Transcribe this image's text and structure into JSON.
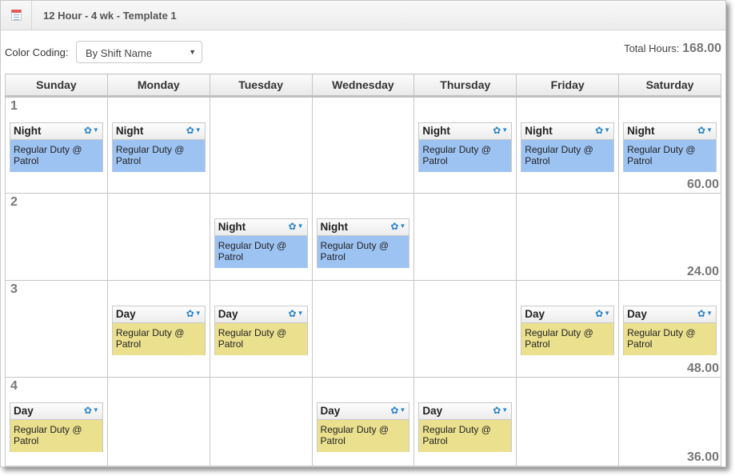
{
  "header": {
    "title": "12 Hour - 4 wk - Template 1",
    "icon": "calendar-icon"
  },
  "toolbar": {
    "color_coding_label": "Color Coding:",
    "color_coding_value": "By Shift Name",
    "total_hours_label": "Total Hours:",
    "total_hours_value": "168.00"
  },
  "colors": {
    "night": "#9dc3f3",
    "day": "#ebe08e",
    "gear": "#2a84c9"
  },
  "days": [
    "Sunday",
    "Monday",
    "Tuesday",
    "Wednesday",
    "Thursday",
    "Friday",
    "Saturday"
  ],
  "weeks": [
    {
      "label": "1",
      "total": "60.00",
      "shifts": [
        {
          "name": "Night",
          "desc": "Regular Duty @ Patrol",
          "type": "night"
        },
        {
          "name": "Night",
          "desc": "Regular Duty @ Patrol",
          "type": "night"
        },
        null,
        null,
        {
          "name": "Night",
          "desc": "Regular Duty @ Patrol",
          "type": "night"
        },
        {
          "name": "Night",
          "desc": "Regular Duty @ Patrol",
          "type": "night"
        },
        {
          "name": "Night",
          "desc": "Regular Duty @ Patrol",
          "type": "night"
        }
      ]
    },
    {
      "label": "2",
      "total": "24.00",
      "shifts": [
        null,
        null,
        {
          "name": "Night",
          "desc": "Regular Duty @ Patrol",
          "type": "night"
        },
        {
          "name": "Night",
          "desc": "Regular Duty @ Patrol",
          "type": "night"
        },
        null,
        null,
        null
      ]
    },
    {
      "label": "3",
      "total": "48.00",
      "shifts": [
        null,
        {
          "name": "Day",
          "desc": "Regular Duty @ Patrol",
          "type": "day"
        },
        {
          "name": "Day",
          "desc": "Regular Duty @ Patrol",
          "type": "day"
        },
        null,
        null,
        {
          "name": "Day",
          "desc": "Regular Duty @ Patrol",
          "type": "day"
        },
        {
          "name": "Day",
          "desc": "Regular Duty @ Patrol",
          "type": "day"
        }
      ]
    },
    {
      "label": "4",
      "total": "36.00",
      "shifts": [
        {
          "name": "Day",
          "desc": "Regular Duty @ Patrol",
          "type": "day"
        },
        null,
        null,
        {
          "name": "Day",
          "desc": "Regular Duty @ Patrol",
          "type": "day"
        },
        {
          "name": "Day",
          "desc": "Regular Duty @ Patrol",
          "type": "day"
        },
        null,
        null
      ]
    }
  ]
}
